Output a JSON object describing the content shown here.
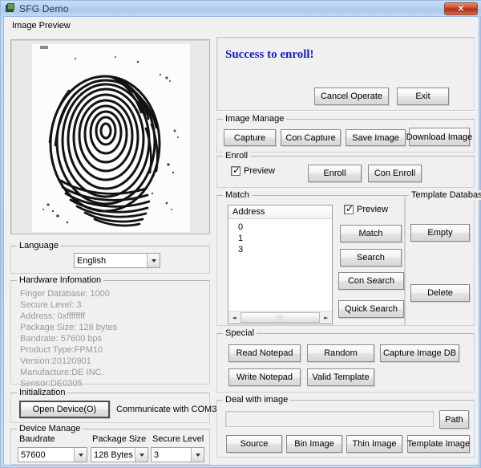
{
  "window": {
    "title": "SFG Demo",
    "app_icon": "app-window-icon",
    "close_label": "✕",
    "close_icon": "close-icon"
  },
  "image_preview": {
    "group_label": "Image Preview",
    "content": "fingerprint-image"
  },
  "message_panel": {
    "text": "Success to enroll!",
    "text_color": "#1a1ac8",
    "cancel_label": "Cancel Operate",
    "exit_label": "Exit"
  },
  "image_manage": {
    "group_label": "Image Manage",
    "buttons": [
      {
        "label": "Capture"
      },
      {
        "label": "Con Capture"
      },
      {
        "label": "Save Image"
      },
      {
        "label": "Download Image"
      }
    ]
  },
  "enroll": {
    "group_label": "Enroll",
    "preview_label": "Preview",
    "preview_checked": true,
    "enroll_label": "Enroll",
    "con_enroll_label": "Con Enroll"
  },
  "match": {
    "group_label": "Match",
    "column_header": "Address",
    "rows": [
      "0",
      "1",
      "3"
    ],
    "preview_label": "Preview",
    "preview_checked": true,
    "buttons": [
      {
        "label": "Match"
      },
      {
        "label": "Search"
      },
      {
        "label": "Con Search"
      },
      {
        "label": "Quick Search"
      }
    ],
    "scroll_left_icon": "◄",
    "scroll_right_icon": "►",
    "scroll_thumb_grip": "⦙⦙⦙"
  },
  "template_database": {
    "group_label": "Template Database",
    "empty_label": "Empty",
    "delete_label": "Delete"
  },
  "special": {
    "group_label": "Special",
    "buttons": [
      {
        "label": "Read Notepad"
      },
      {
        "label": "Random"
      },
      {
        "label": "Capture Image DB"
      },
      {
        "label": "Write Notepad"
      },
      {
        "label": "Valid Template"
      }
    ]
  },
  "deal_with_image": {
    "group_label": "Deal with image",
    "path_value": "",
    "path_placeholder": "",
    "path_button_label": "Path",
    "buttons": [
      {
        "label": "Source"
      },
      {
        "label": "Bin Image"
      },
      {
        "label": "Thin Image"
      },
      {
        "label": "Template Image"
      }
    ]
  },
  "language": {
    "group_label": "Language",
    "selected": "English",
    "options": [
      "English"
    ]
  },
  "hardware_information": {
    "group_label": "Hardware Infomation",
    "lines": [
      "Finger Database: 1000",
      "Secure Level: 3",
      "Address: 0xffffffff",
      "Package Size: 128 bytes",
      "Bandrate: 57600 bps",
      "Product Type:FPM10",
      "Version:20120901",
      "Manufacture:DE INC.",
      "Sensor:DE0305"
    ]
  },
  "initialization": {
    "group_label": "Initialization",
    "open_device_label": "Open Device(O)",
    "status_text": "Communicate with COM3"
  },
  "device_manage": {
    "group_label": "Device Manage",
    "fields": [
      {
        "label": "Baudrate",
        "selected": "57600",
        "options": [
          "57600"
        ]
      },
      {
        "label": "Package Size",
        "selected": "128 Bytes",
        "options": [
          "128 Bytes"
        ]
      },
      {
        "label": "Secure Level",
        "selected": "3",
        "options": [
          "3"
        ]
      }
    ]
  }
}
